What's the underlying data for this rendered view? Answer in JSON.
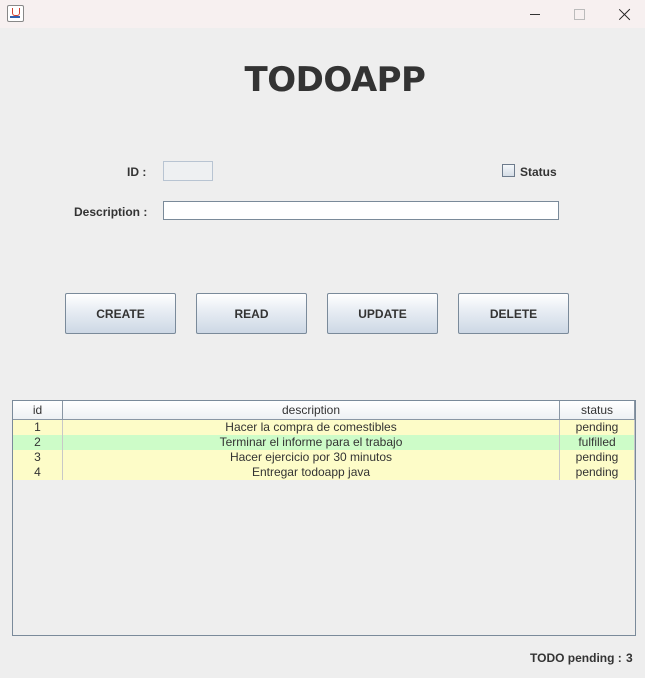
{
  "window": {
    "title": ""
  },
  "header": {
    "title": "TODOAPP"
  },
  "form": {
    "id_label": "ID :",
    "id_value": "",
    "status_label": "Status",
    "status_checked": false,
    "description_label": "Description :",
    "description_value": ""
  },
  "buttons": {
    "create": "CREATE",
    "read": "READ",
    "update": "UPDATE",
    "delete": "DELETE"
  },
  "table": {
    "columns": [
      "id",
      "description",
      "status"
    ],
    "rows": [
      {
        "id": "1",
        "description": "Hacer la compra de comestibles",
        "status": "pending"
      },
      {
        "id": "2",
        "description": "Terminar el informe para el trabajo",
        "status": "fulfilled"
      },
      {
        "id": "3",
        "description": "Hacer ejercicio por 30 minutos",
        "status": "pending"
      },
      {
        "id": "4",
        "description": "Entregar todoapp java",
        "status": "pending"
      }
    ],
    "row_colors": {
      "pending": "#fdfcc8",
      "fulfilled": "#cdfcc8"
    }
  },
  "footer": {
    "pending_label": "TODO pending :",
    "pending_count": "3"
  },
  "icons": {
    "app": "java-icon",
    "minimize": "minimize-icon",
    "maximize": "maximize-icon",
    "close": "close-icon"
  }
}
